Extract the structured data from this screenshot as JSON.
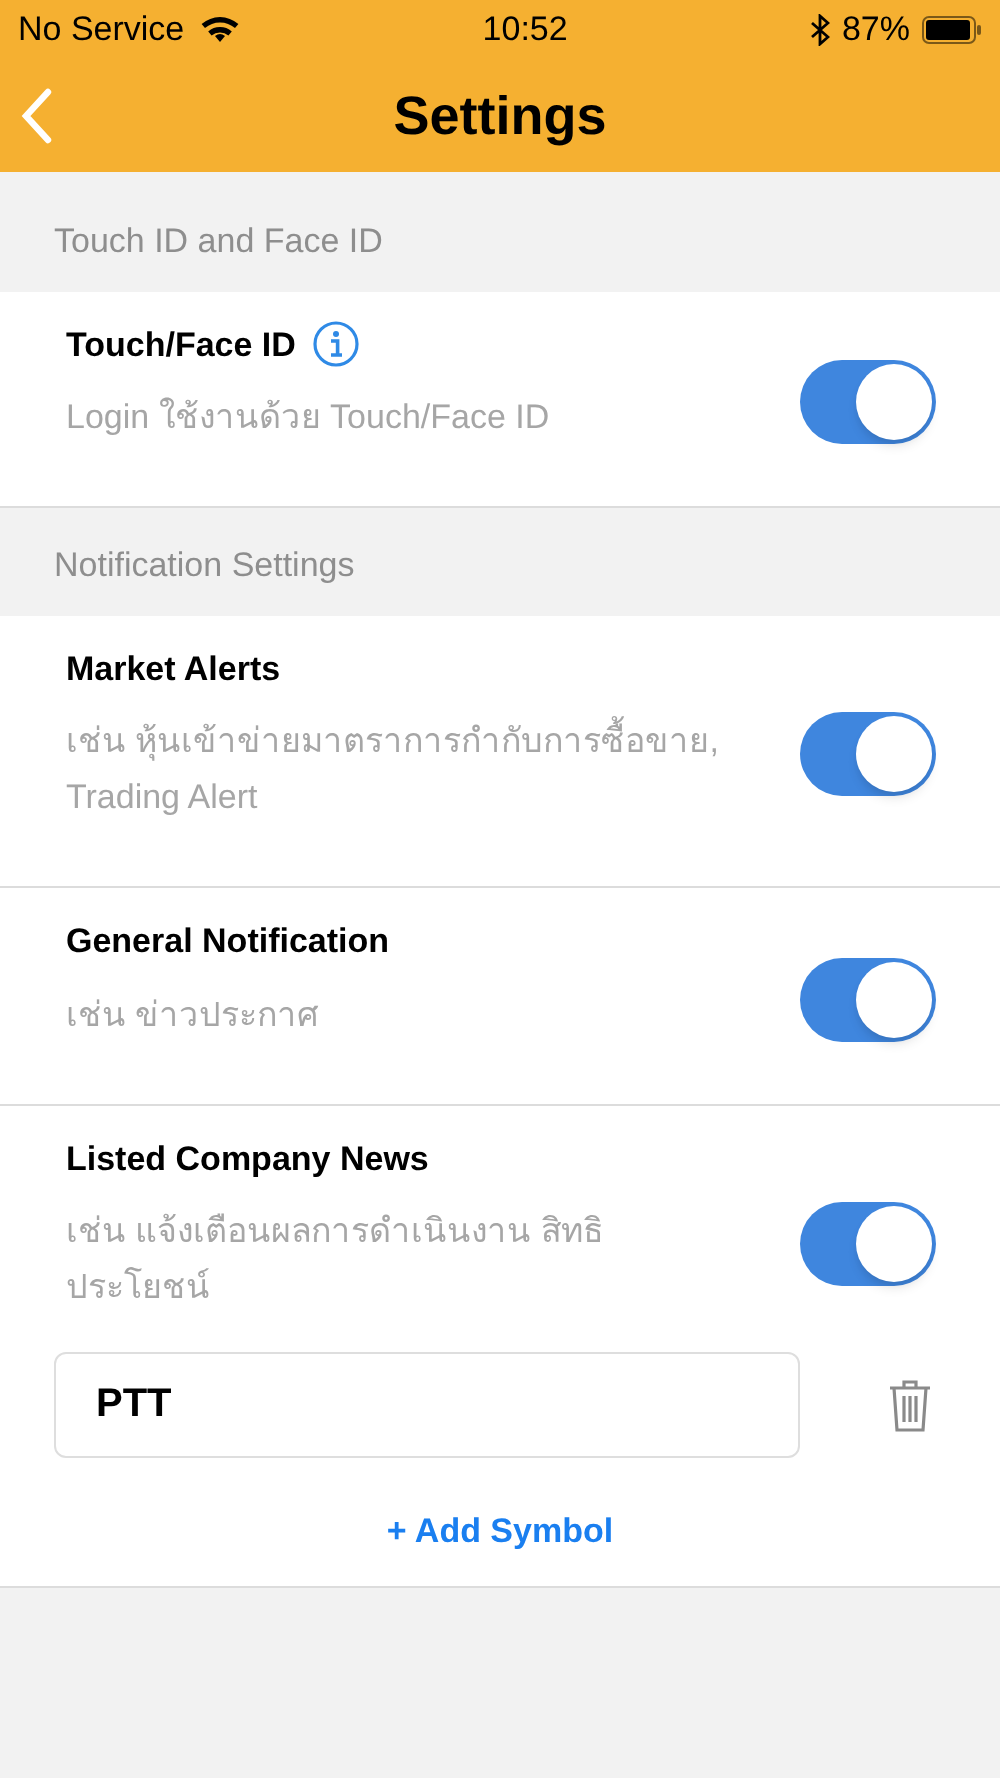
{
  "status_bar": {
    "carrier": "No Service",
    "time": "10:52",
    "battery": "87%"
  },
  "nav": {
    "title": "Settings"
  },
  "sections": [
    {
      "header": "Touch ID and Face ID",
      "rows": [
        {
          "title": "Touch/Face ID",
          "info": true,
          "subtitle": "Login ใช้งานด้วย Touch/Face ID",
          "on": true
        }
      ]
    },
    {
      "header": "Notification Settings",
      "rows": [
        {
          "title": "Market Alerts",
          "info": false,
          "subtitle": "เช่น หุ้นเข้าข่ายมาตราการกำกับการซื้อขาย, Trading Alert",
          "on": true
        },
        {
          "title": "General Notification",
          "info": false,
          "subtitle": "เช่น ข่าวประกาศ",
          "on": true
        },
        {
          "title": "Listed Company News",
          "info": false,
          "subtitle": "เช่น แจ้งเตือนผลการดำเนินงาน สิทธิประโยชน์",
          "on": true,
          "symbols": [
            "PTT"
          ],
          "add_label": "+ Add Symbol"
        }
      ]
    }
  ]
}
